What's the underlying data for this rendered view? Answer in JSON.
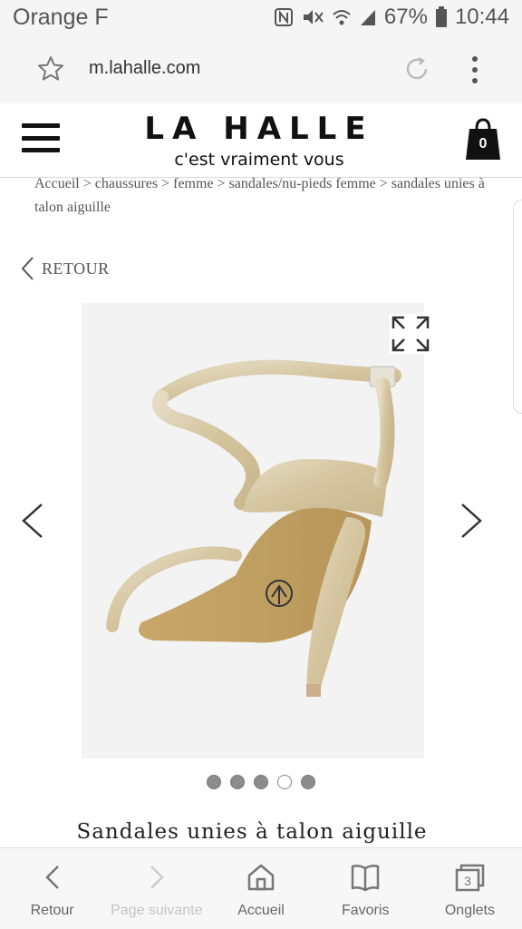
{
  "status_bar": {
    "carrier": "Orange F",
    "battery": "67%",
    "time": "10:44"
  },
  "browser": {
    "url": "m.lahalle.com"
  },
  "header": {
    "brand_name": "LA HALLE",
    "tagline": "c'est vraiment vous",
    "cart_count": "0"
  },
  "breadcrumb": {
    "items": [
      "Accueil",
      "chaussures",
      "femme",
      "sandales/nu-pieds femme",
      "sandales unies à talon aiguille"
    ],
    "separator": ">"
  },
  "retour_label": "RETOUR",
  "carousel": {
    "dots": 5,
    "active_index": 3
  },
  "product": {
    "title": "Sandales unies à talon aiguille"
  },
  "bottom_nav": {
    "items": [
      {
        "label": "Retour",
        "icon": "back-icon"
      },
      {
        "label": "Page suivante",
        "icon": "forward-icon"
      },
      {
        "label": "Accueil",
        "icon": "home-icon"
      },
      {
        "label": "Favoris",
        "icon": "bookmark-icon"
      },
      {
        "label": "Onglets",
        "icon": "tabs-icon"
      }
    ],
    "tabs_count": "3"
  }
}
